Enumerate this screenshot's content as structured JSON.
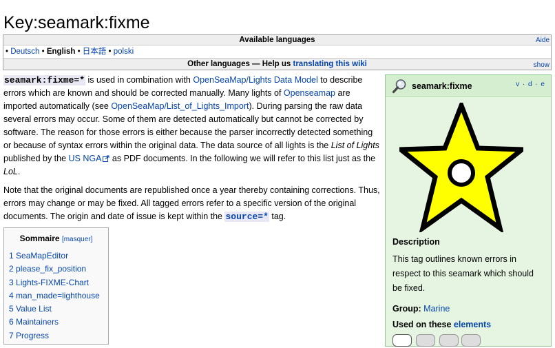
{
  "page": {
    "title": "Key:seamark:fixme"
  },
  "languages": {
    "available_label": "Available languages",
    "help_label": "Aide",
    "items": [
      "Deutsch",
      "English",
      "日本語",
      "polski"
    ],
    "separator": " • ",
    "bullet": "•",
    "other_label": "Other languages — Help us",
    "translate_link": "translating this wiki",
    "show_label": "show"
  },
  "body": {
    "p1": {
      "tag": "seamark:fixme=*",
      "t1": " is used in combination with ",
      "link1": "OpenSeaMap/Lights Data Model",
      "t2": " to describe errors which are known and should be corrected manually. Many lights of ",
      "link2": "Openseamap",
      "t3": " are imported automatically (see ",
      "link3": "OpenSeaMap/List_of_Lights_Import",
      "t4": "). During parsing the raw data several errors may occur. Some of them are detected automatically but cannot be corrected by software. The reason for those errors is either because the parser incorrectly detected something or because of syntax errors within the original data. The data source of all lights is the ",
      "em1": "List of Lights",
      "t5": " published by the ",
      "link4": "US NGA",
      "t6": " as PDF documents. In the following we will refer to this list just as the ",
      "em2": "LoL",
      "t7": "."
    },
    "p2": {
      "t1": "Note that the original documents are republished once a year thereby containing corrections. Thus, errors may change or may be fixed. All tagged errors refer to a specific version of the original documents. The origin and date of issue is kept within the ",
      "tag": "source=*",
      "t2": " tag."
    }
  },
  "toc": {
    "title": "Sommaire",
    "toggle": "[masquer]",
    "items": [
      {
        "num": "1",
        "label": "SeaMapEditor"
      },
      {
        "num": "2",
        "label": "please_fix_position"
      },
      {
        "num": "3",
        "label": "Lights-FIXME-Chart"
      },
      {
        "num": "4",
        "label": "man_made=lighthouse"
      },
      {
        "num": "5",
        "label": "Value List"
      },
      {
        "num": "6",
        "label": "Maintainers"
      },
      {
        "num": "7",
        "label": "Progress"
      }
    ]
  },
  "infobox": {
    "name": "seamark:fixme",
    "vde": "v · d · e",
    "description_label": "Description",
    "description": "This tag outlines known errors in respect to this seamark which should be fixed.",
    "group_label": "Group:",
    "group_value": "Marine",
    "used_on_label": "Used on these",
    "used_on_link": "elements",
    "colors": {
      "star_fill": "#ffff00",
      "box_bg": "#e6f5e1",
      "header_bg": "#d6eed0"
    },
    "icons": [
      "magnifier-icon",
      "star-icon",
      "node-icon",
      "way-icon",
      "area-icon",
      "relation-icon"
    ]
  }
}
